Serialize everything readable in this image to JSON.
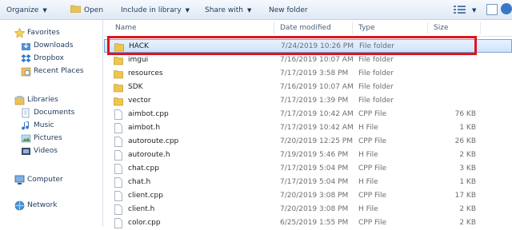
{
  "toolbar": {
    "organize": "Organize",
    "open": "Open",
    "include": "Include in library",
    "share": "Share with",
    "new_folder": "New folder"
  },
  "nav": {
    "favorites": "Favorites",
    "downloads": "Downloads",
    "dropbox": "Dropbox",
    "recent": "Recent Places",
    "libraries": "Libraries",
    "documents": "Documents",
    "music": "Music",
    "pictures": "Pictures",
    "videos": "Videos",
    "computer": "Computer",
    "network": "Network"
  },
  "columns": {
    "name": "Name",
    "date": "Date modified",
    "type": "Type",
    "size": "Size"
  },
  "files": [
    {
      "name": "HACK",
      "date": "7/24/2019 10:26 PM",
      "type": "File folder",
      "size": "",
      "kind": "folder"
    },
    {
      "name": "imgui",
      "date": "7/16/2019 10:07 AM",
      "type": "File folder",
      "size": "",
      "kind": "folder"
    },
    {
      "name": "resources",
      "date": "7/17/2019 3:58 PM",
      "type": "File folder",
      "size": "",
      "kind": "folder"
    },
    {
      "name": "SDK",
      "date": "7/16/2019 10:07 AM",
      "type": "File folder",
      "size": "",
      "kind": "folder"
    },
    {
      "name": "vector",
      "date": "7/17/2019 1:39 PM",
      "type": "File folder",
      "size": "",
      "kind": "folder"
    },
    {
      "name": "aimbot.cpp",
      "date": "7/17/2019 10:42 AM",
      "type": "CPP File",
      "size": "76 KB",
      "kind": "file"
    },
    {
      "name": "aimbot.h",
      "date": "7/17/2019 10:42 AM",
      "type": "H File",
      "size": "1 KB",
      "kind": "file"
    },
    {
      "name": "autoroute.cpp",
      "date": "7/20/2019 12:25 PM",
      "type": "CPP File",
      "size": "26 KB",
      "kind": "file"
    },
    {
      "name": "autoroute.h",
      "date": "7/19/2019 5:46 PM",
      "type": "H File",
      "size": "2 KB",
      "kind": "file"
    },
    {
      "name": "chat.cpp",
      "date": "7/17/2019 5:04 PM",
      "type": "CPP File",
      "size": "3 KB",
      "kind": "file"
    },
    {
      "name": "chat.h",
      "date": "7/17/2019 5:04 PM",
      "type": "H File",
      "size": "1 KB",
      "kind": "file"
    },
    {
      "name": "client.cpp",
      "date": "7/20/2019 3:08 PM",
      "type": "CPP File",
      "size": "17 KB",
      "kind": "file"
    },
    {
      "name": "client.h",
      "date": "7/20/2019 3:08 PM",
      "type": "H File",
      "size": "2 KB",
      "kind": "file"
    },
    {
      "name": "color.cpp",
      "date": "6/25/2019 1:55 PM",
      "type": "CPP File",
      "size": "2 KB",
      "kind": "file"
    }
  ],
  "colors": {
    "highlight": "#e0141e",
    "folder": "#f0c64a",
    "selection": "#cbe4fd"
  }
}
